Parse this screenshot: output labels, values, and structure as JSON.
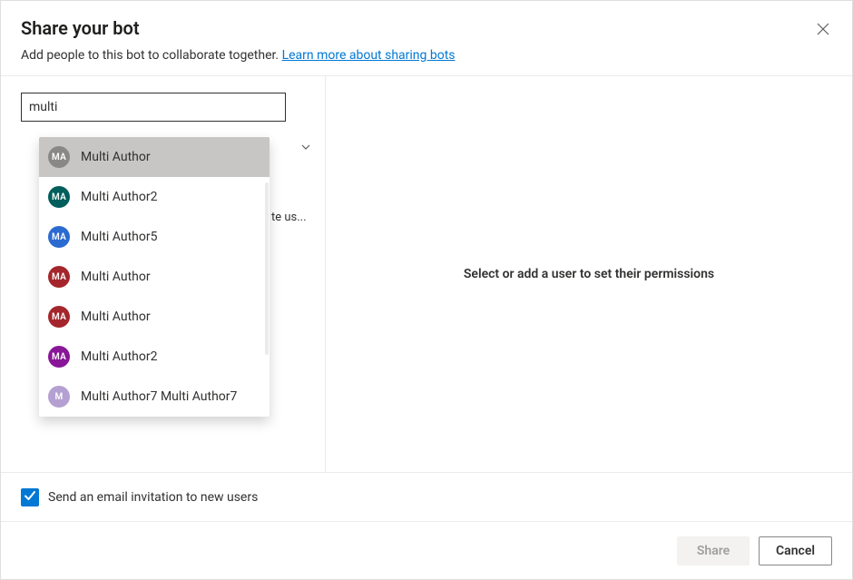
{
  "header": {
    "title": "Share your bot",
    "subtitle_prefix": "Add people to this bot to collaborate together. ",
    "learn_more": "Learn more about sharing bots"
  },
  "search": {
    "value": "multi",
    "hidden_row_text": "te us..."
  },
  "suggestions": [
    {
      "initials": "MA",
      "label": "Multi Author",
      "color": "#8a8886",
      "highlight": true
    },
    {
      "initials": "MA",
      "label": "Multi Author2",
      "color": "#005e5d"
    },
    {
      "initials": "MA",
      "label": "Multi Author5",
      "color": "#2b6bd1"
    },
    {
      "initials": "MA",
      "label": "Multi Author",
      "color": "#a4262c"
    },
    {
      "initials": "MA",
      "label": "Multi Author",
      "color": "#a4262c"
    },
    {
      "initials": "MA",
      "label": "Multi Author2",
      "color": "#881798"
    },
    {
      "initials": "M",
      "label": "Multi Author7 Multi Author7",
      "color": "#b4a0d1"
    }
  ],
  "right_pane": {
    "empty_message": "Select or add a user to set their permissions"
  },
  "email_invite": {
    "checked": true,
    "label": "Send an email invitation to new users"
  },
  "footer": {
    "share": "Share",
    "cancel": "Cancel"
  }
}
